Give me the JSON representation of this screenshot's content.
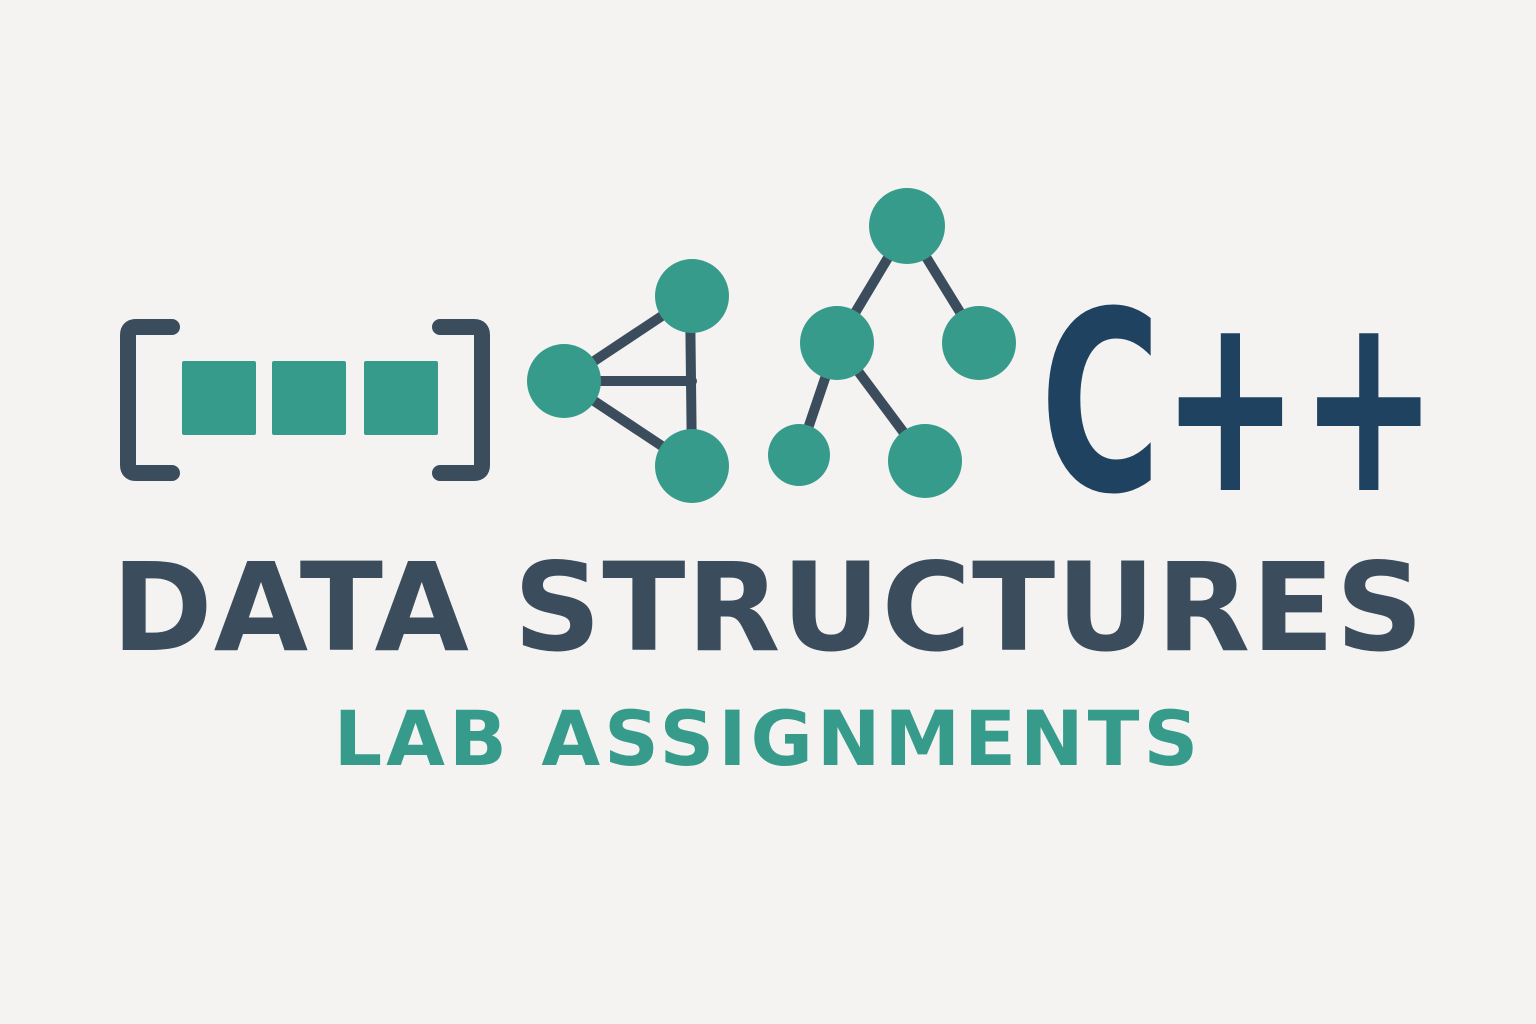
{
  "colors": {
    "background": "#f4f3f1",
    "teal": "#379b8c",
    "slate": "#3b4d5c",
    "navy": "#1f4260"
  },
  "logo": {
    "language_mark": "C++"
  },
  "headline": {
    "title": "DATA STRUCTURES",
    "subtitle": "LAB ASSIGNMENTS"
  },
  "icons": [
    "array-icon",
    "graph-icon",
    "tree-icon"
  ]
}
